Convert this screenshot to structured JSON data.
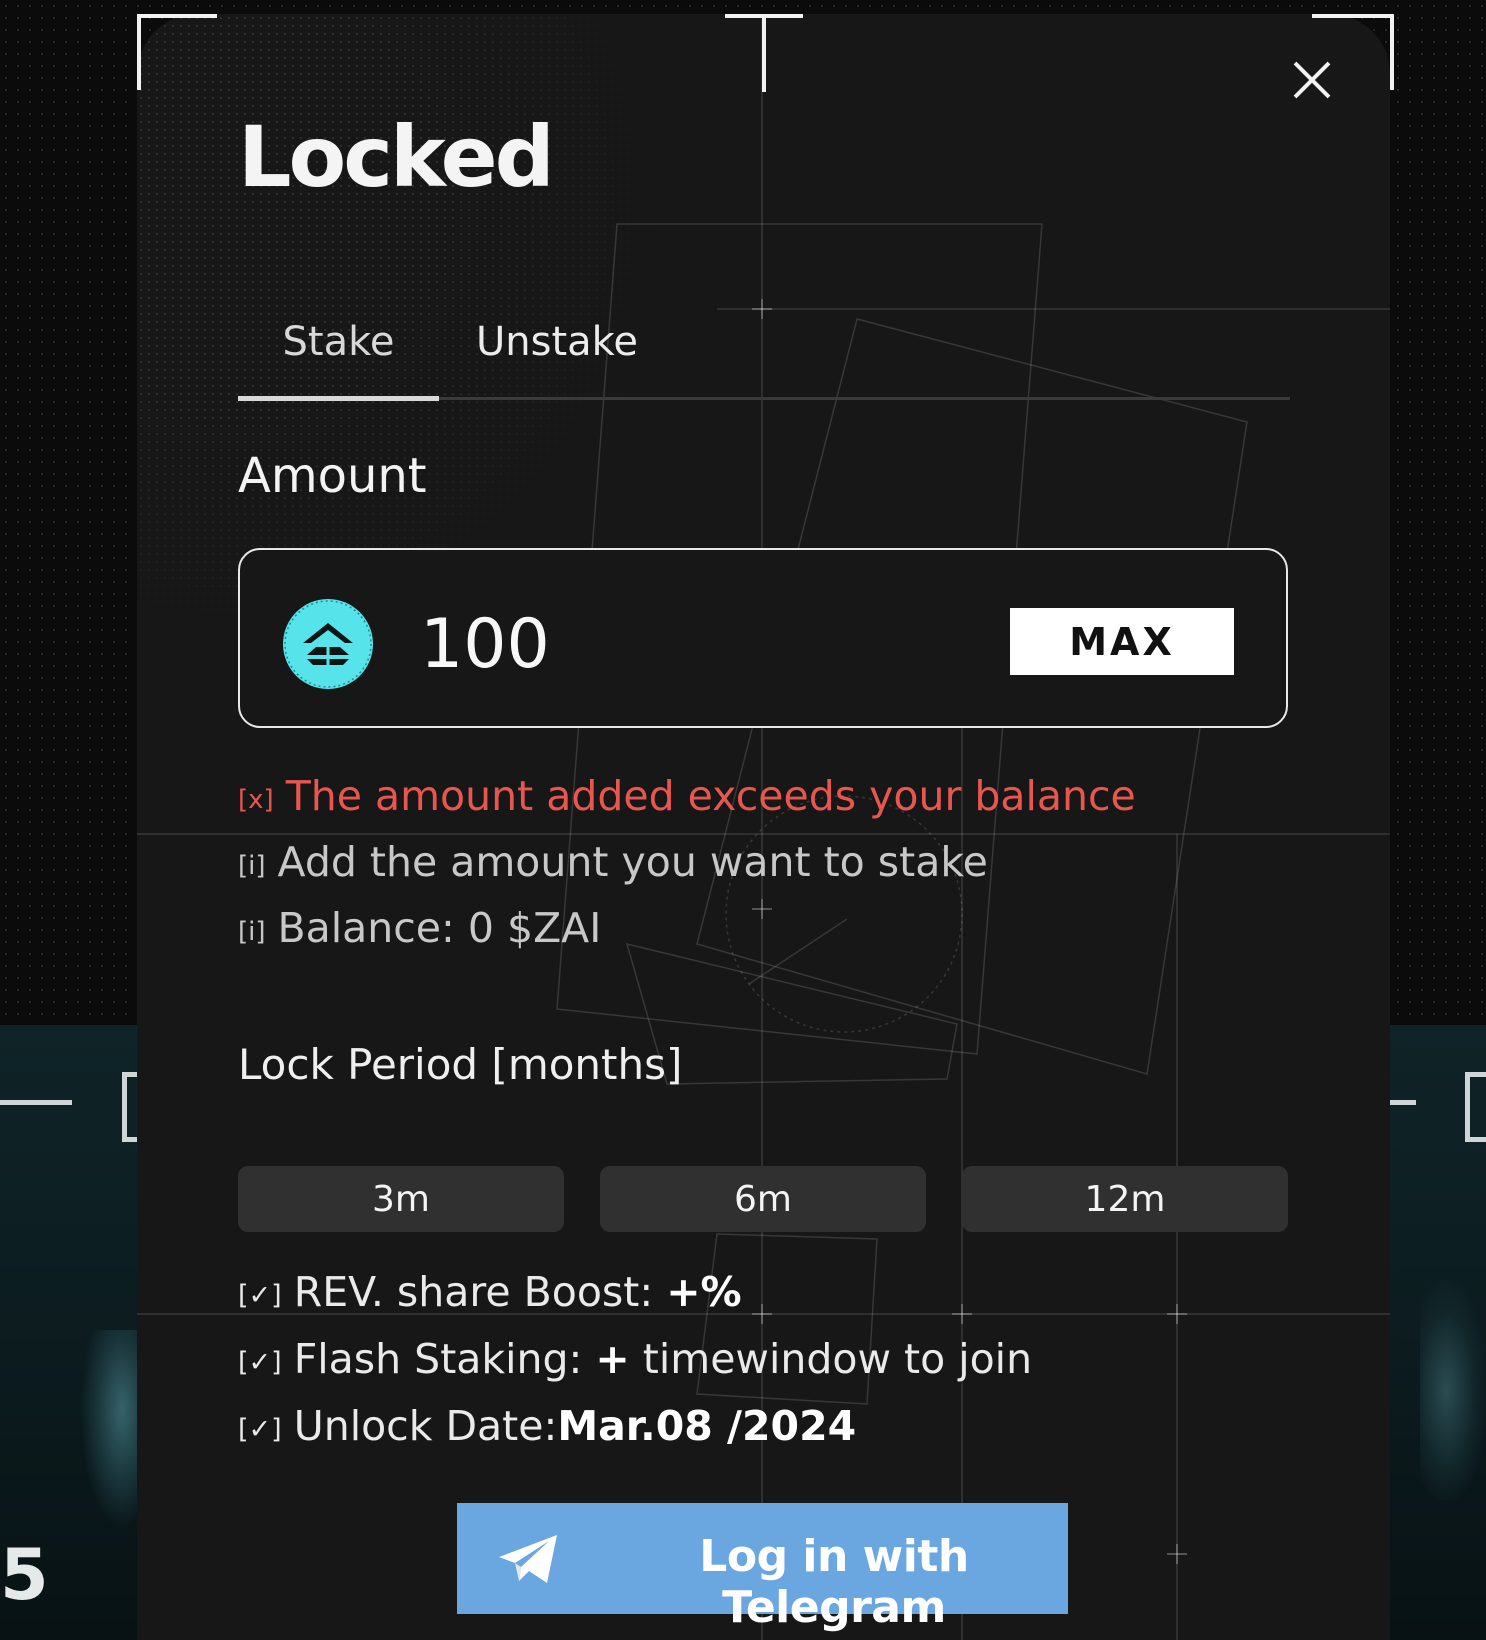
{
  "modal": {
    "title": "Locked",
    "close_icon": "close-icon"
  },
  "tabs": [
    {
      "label": "Stake",
      "active": true
    },
    {
      "label": "Unstake",
      "active": false
    }
  ],
  "amount": {
    "label": "Amount",
    "value": "100",
    "token_icon": "zai-token-icon",
    "token_color": "#56e3ea",
    "max_label": "MAX"
  },
  "messages": {
    "error_prefix": "[x]",
    "error": "The amount added exceeds your balance",
    "hint_prefix": "[i]",
    "hint": "Add the amount you want to stake",
    "balance_prefix": "[i]",
    "balance": "Balance: 0 $ZAI"
  },
  "lock_period": {
    "label": "Lock Period [months]",
    "options": [
      "3m",
      "6m",
      "12m"
    ]
  },
  "benefits": {
    "prefix": "[✓]",
    "rev_label": "REV. share Boost: ",
    "rev_value": "+%",
    "flash_label": "Flash Staking: ",
    "flash_value": "+",
    "flash_suffix": " timewindow to join",
    "unlock_label": "Unlock Date:",
    "unlock_value": "Mar.08 /2024"
  },
  "login": {
    "label": "Log in with Telegram",
    "icon": "telegram-icon",
    "color": "#6aa6e0"
  },
  "background": {
    "corner_glyph": "5"
  }
}
